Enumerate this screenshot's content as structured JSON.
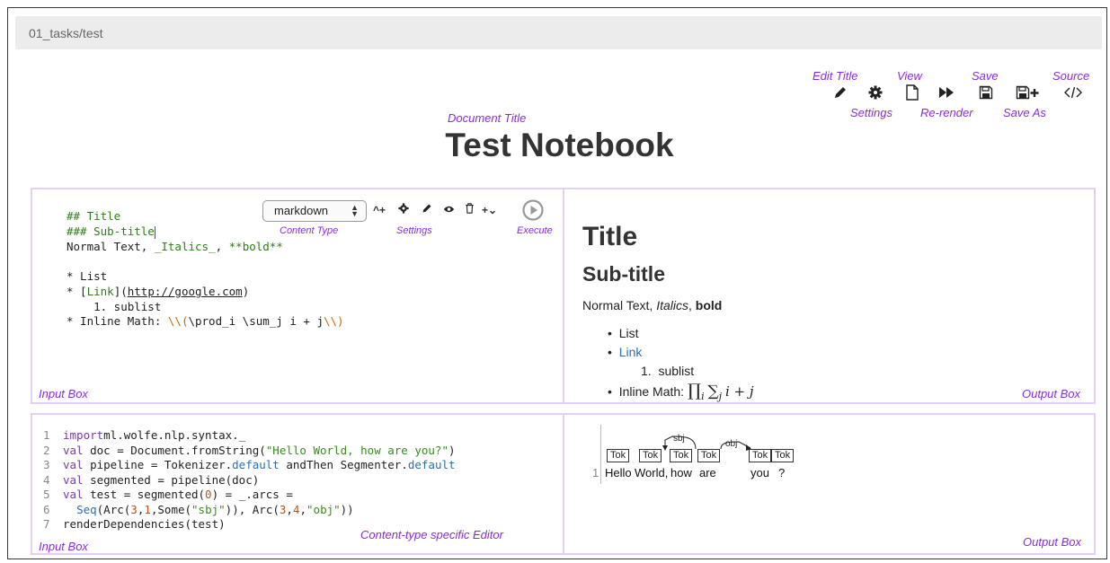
{
  "breadcrumb": "01_tasks/test",
  "toolbar": {
    "labels": {
      "edit_title": "Edit Title",
      "view": "View",
      "save": "Save",
      "source": "Source",
      "settings": "Settings",
      "rerender": "Re-render",
      "save_as": "Save As"
    },
    "icons": [
      "pencil-icon",
      "gear-icon",
      "page-icon",
      "fast-forward-icon",
      "floppy-icon",
      "floppy-plus-icon",
      "code-icon"
    ]
  },
  "document": {
    "title_annotation": "Document Title",
    "title": "Test Notebook"
  },
  "cell1": {
    "input_lines": {
      "l1": "## Title",
      "l2": "### Sub-title",
      "l3a": "Normal Text, ",
      "l3b": "_Italics_",
      "l3c": ", ",
      "l3d": "**bold**",
      "l4": "* List",
      "l5a": "* [",
      "l5b": "Link",
      "l5c": "](",
      "l5d": "http://google.com",
      "l5e": ")",
      "l6": "    1. sublist",
      "l7a": "* Inline Math: ",
      "l7b": "\\\\(",
      "l7c": "\\prod_i \\sum_j i + j",
      "l7d": "\\\\)"
    },
    "content_type": "markdown",
    "annotations": {
      "content_type": "Content Type",
      "settings": "Settings",
      "execute": "Execute",
      "input_box": "Input Box",
      "output_box": "Output Box"
    },
    "output": {
      "title": "Title",
      "subtitle": "Sub-title",
      "normal_text": "Normal Text, ",
      "italics": "Italics",
      "comma": ", ",
      "bold": "bold",
      "list_item": "List",
      "link": "Link",
      "sublist": "sublist",
      "inline_math_label": "Inline Math: ",
      "math": "∏",
      "math_sub_i": "i",
      "math_sum": "∑",
      "math_sub_j": "j",
      "math_rest": "i + j"
    }
  },
  "cell2": {
    "code": [
      {
        "n": "1",
        "parts": [
          [
            "kw",
            "import"
          ],
          [
            "",
            "ml.wolfe.nlp.syntax._"
          ]
        ]
      },
      {
        "n": "2",
        "parts": [
          [
            "kw",
            "val"
          ],
          [
            "",
            " doc = Document.fromString("
          ],
          [
            "str",
            "\"Hello World, how are you?\""
          ],
          [
            "",
            ")"
          ]
        ]
      },
      {
        "n": "3",
        "parts": [
          [
            "kw",
            "val"
          ],
          [
            "",
            " pipeline = Tokenizer."
          ],
          [
            "ty",
            "default"
          ],
          [
            "",
            " andThen Segmenter."
          ],
          [
            "ty",
            "default"
          ]
        ]
      },
      {
        "n": "4",
        "parts": [
          [
            "kw",
            "val"
          ],
          [
            "",
            " segmented = pipeline(doc)"
          ]
        ]
      },
      {
        "n": "5",
        "parts": [
          [
            "kw",
            "val"
          ],
          [
            "",
            " test = segmented("
          ],
          [
            "num",
            "0"
          ],
          [
            "",
            ") = _.arcs ="
          ]
        ]
      },
      {
        "n": "6",
        "parts": [
          [
            "",
            "  "
          ],
          [
            "ty",
            "Seq"
          ],
          [
            "",
            "(Arc("
          ],
          [
            "num",
            "3"
          ],
          [
            "",
            ","
          ],
          [
            "num",
            "1"
          ],
          [
            "",
            ",Some("
          ],
          [
            "str",
            "\"sbj\""
          ],
          [
            "",
            "))"
          ],
          [
            "",
            ", Arc("
          ],
          [
            "num",
            "3"
          ],
          [
            "",
            ","
          ],
          [
            "num",
            "4"
          ],
          [
            "",
            ","
          ],
          [
            "str",
            "\"obj\""
          ],
          [
            "",
            "))"
          ]
        ]
      },
      {
        "n": "7",
        "parts": [
          [
            "",
            "renderDependencies(test)"
          ]
        ]
      }
    ],
    "annotations": {
      "editor": "Content-type specific Editor",
      "input_box": "Input Box",
      "output_box": "Output Box"
    },
    "dependency": {
      "line_number": "1",
      "token_label": "Tok",
      "words": [
        "Hello",
        "World,",
        "how",
        "are",
        "you",
        "?"
      ],
      "arcs": [
        "sbj",
        "obj"
      ]
    }
  },
  "colors": {
    "annotation": "#8a2be2",
    "box_border": "#e2cff2",
    "link": "#2a6fb0"
  }
}
